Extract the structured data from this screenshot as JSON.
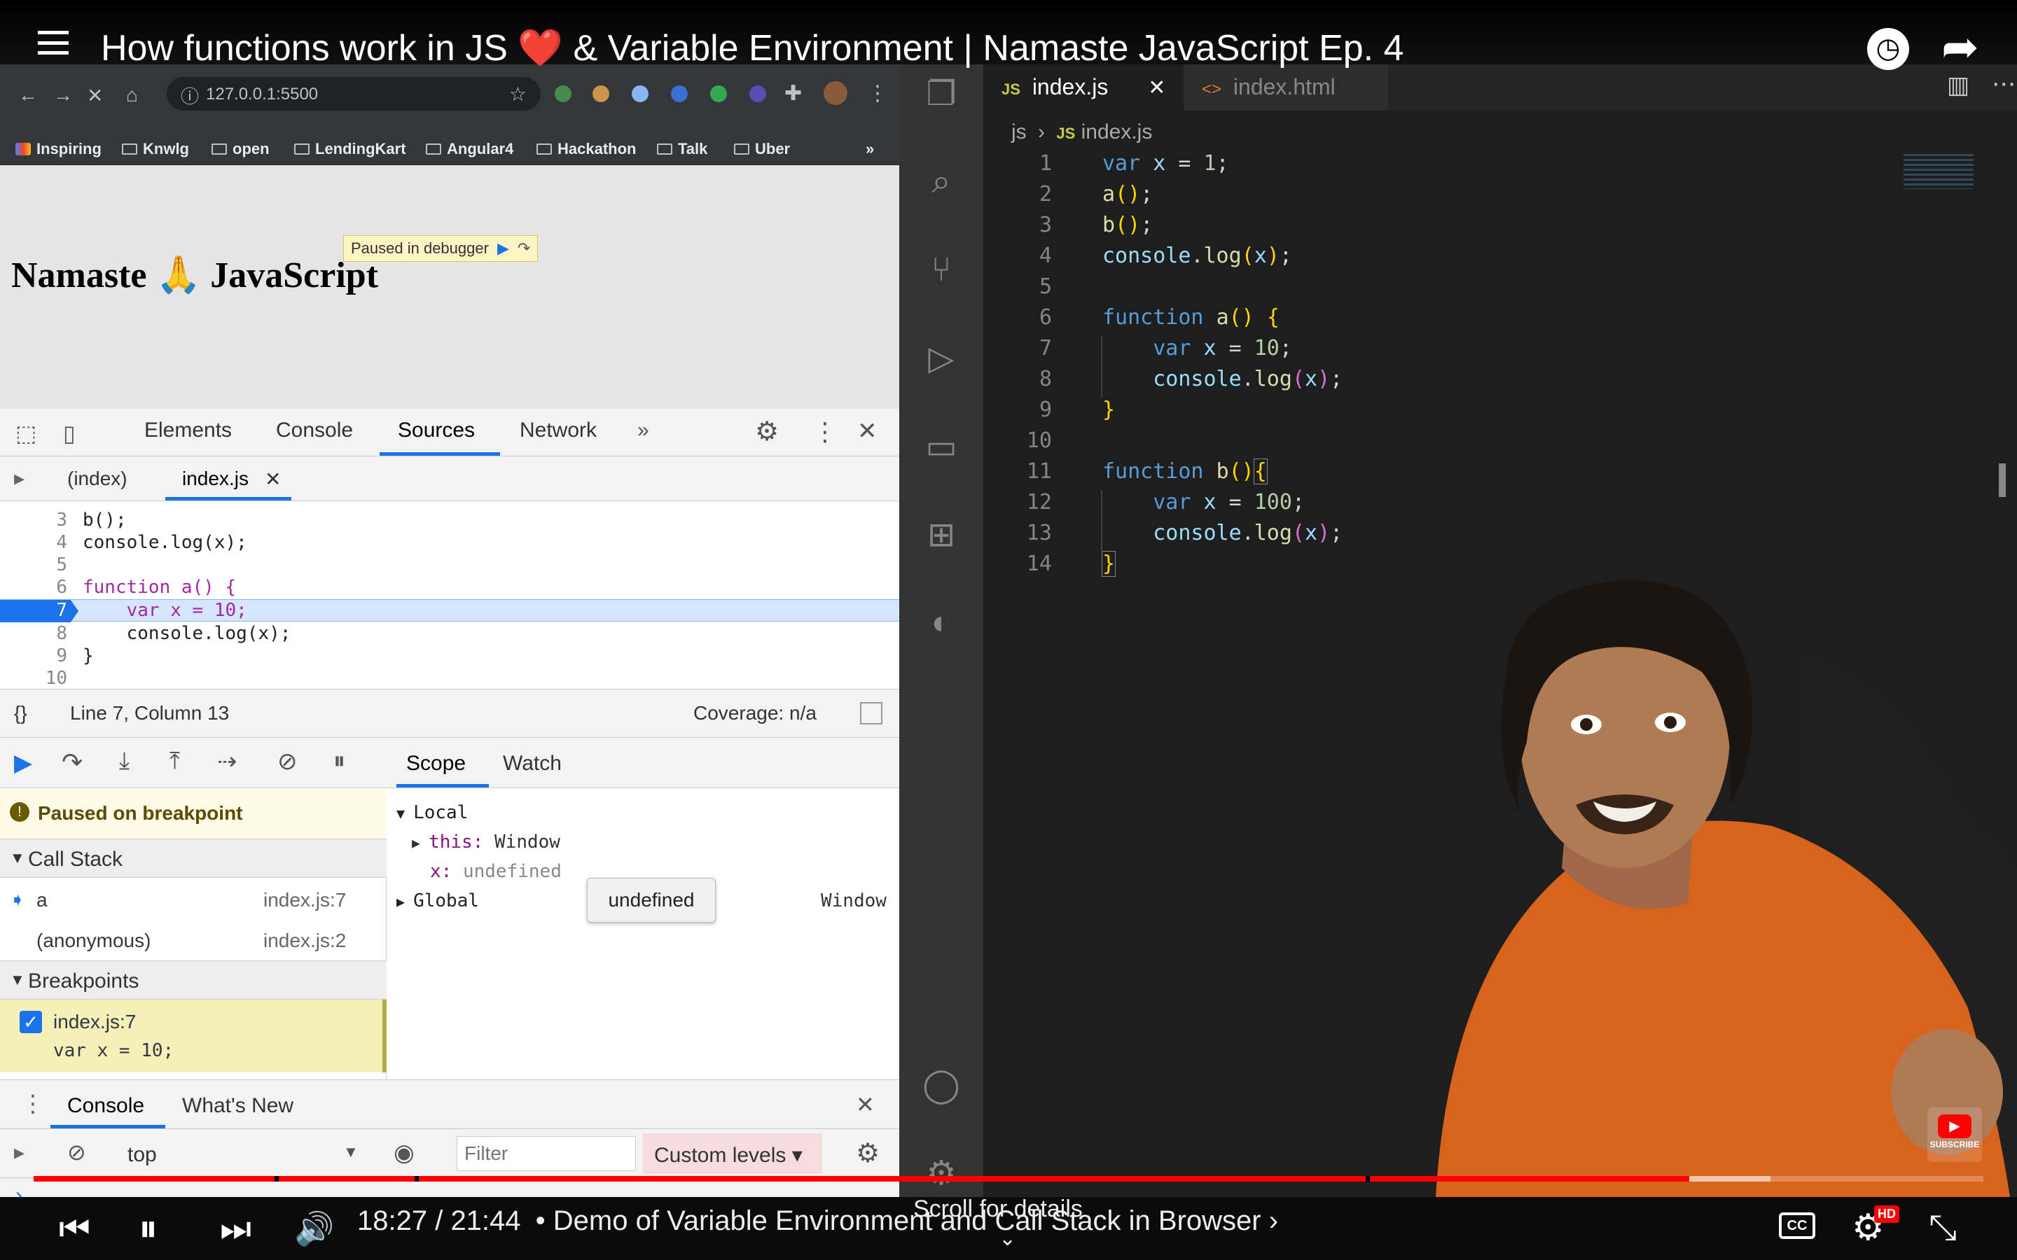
{
  "video": {
    "title": "How functions work in JS ❤️ & Variable Environment | Namaste JavaScript Ep. 4",
    "time": "18:27 / 21:44",
    "chapter": "• Demo of Variable Environment and Call Stack in Browser ›",
    "scroll_hint": "Scroll for details",
    "subscribe_label": "SUBSCRIBE",
    "hd_badge": "HD",
    "cc_label": "CC",
    "progress": 0.849
  },
  "browser": {
    "url": "127.0.0.1:5500",
    "bookmarks": [
      "Inspiring",
      "Knwlg",
      "open",
      "LendingKart",
      "Angular4",
      "Hackathon",
      "Talk",
      "Uber"
    ],
    "bookmarks_more": "»",
    "page_title": "Namaste 🙏 JavaScript",
    "paused_banner": "Paused in debugger"
  },
  "devtools": {
    "tabs": [
      "Elements",
      "Console",
      "Sources",
      "Network"
    ],
    "tabs_more": "»",
    "active_tab": "Sources",
    "files": [
      "(index)",
      "index.js"
    ],
    "code_lines": [
      {
        "n": "3",
        "t": "b();"
      },
      {
        "n": "4",
        "t": "console.log(x);"
      },
      {
        "n": "5",
        "t": ""
      },
      {
        "n": "6",
        "t": "function a() {"
      },
      {
        "n": "7",
        "t": "    var x = 10;"
      },
      {
        "n": "8",
        "t": "    console.log(x);"
      },
      {
        "n": "9",
        "t": "}"
      },
      {
        "n": "10",
        "t": ""
      }
    ],
    "status_position": "Line 7, Column 13",
    "coverage": "Coverage: n/a",
    "format_label": "{}",
    "paused_msg": "Paused on breakpoint",
    "call_stack_label": "Call Stack",
    "call_stack": [
      {
        "fn": "a",
        "loc": "index.js:7"
      },
      {
        "fn": "(anonymous)",
        "loc": "index.js:2"
      }
    ],
    "breakpoints_label": "Breakpoints",
    "breakpoint": {
      "file": "index.js:7",
      "code": "var x = 10;"
    },
    "scope_tabs": [
      "Scope",
      "Watch"
    ],
    "local_label": "Local",
    "this_key": "this:",
    "this_val": "Window",
    "x_key": "x:",
    "x_val": "undefined",
    "global_label": "Global",
    "global_val": "Window",
    "tooltip": "undefined",
    "drawer_tabs": [
      "Console",
      "What's New"
    ],
    "context": "top",
    "filter_placeholder": "Filter",
    "levels": "Custom levels ▾",
    "prompt": "›"
  },
  "vscode": {
    "tabs": [
      {
        "label": "index.js",
        "prefix": "JS",
        "active": true
      },
      {
        "label": "index.html",
        "prefix": "<>",
        "active": false
      }
    ],
    "breadcrumb_folder": "js",
    "breadcrumb_file": "index.js",
    "lines": [
      "1",
      "2",
      "3",
      "4",
      "5",
      "6",
      "7",
      "8",
      "9",
      "10",
      "11",
      "12",
      "13",
      "14"
    ]
  },
  "colors": {
    "youtube_red": "#ff0000",
    "vscode_bg": "#1e1e1e",
    "breakpoint_blue": "#1a73e8",
    "kurta_orange": "#d8631c"
  }
}
